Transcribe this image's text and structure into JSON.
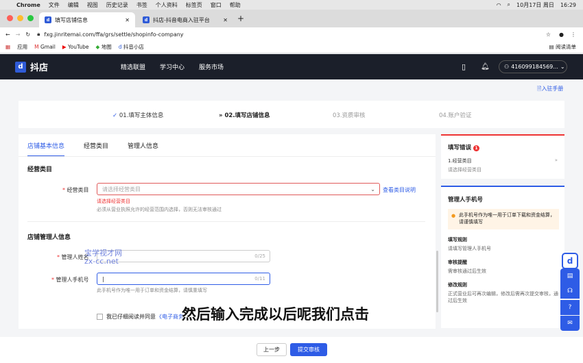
{
  "macbar": {
    "apple": "",
    "app": "Chrome",
    "menus": [
      "文件",
      "编辑",
      "视图",
      "历史记录",
      "书签",
      "个人资料",
      "标签页",
      "窗口",
      "帮助"
    ],
    "date": "10月17日 周日",
    "time": "16:29"
  },
  "tabs": [
    {
      "title": "填写店铺信息",
      "active": true
    },
    {
      "title": "抖店-抖音电商入驻平台",
      "active": false
    }
  ],
  "url": "fxg.jinritemai.com/ffa/grs/settle/shopinfo-company",
  "bookmarks": [
    "应用",
    "Gmail",
    "YouTube",
    "地图",
    "抖音小店"
  ],
  "reading_list": "阅读清单",
  "header": {
    "logo": "抖店",
    "nav": [
      "精选联盟",
      "学习中心",
      "服务市场"
    ],
    "account": "416099184569..."
  },
  "entry_manual": "入驻手册",
  "steps": [
    {
      "label": "01.填写主体信息",
      "state": "done"
    },
    {
      "label": "02.填写店铺信息",
      "state": "current"
    },
    {
      "label": "03.资质审核",
      "state": "todo"
    },
    {
      "label": "04.账户验证",
      "state": "todo"
    }
  ],
  "form_tabs": [
    "店铺基本信息",
    "经营类目",
    "管理人信息"
  ],
  "category": {
    "section": "经营类目",
    "label": "经营类目",
    "placeholder": "请选择经营类目",
    "link": "查看类目说明",
    "error": "请选择经营类目",
    "hint": "必须从营业执照允许的经营范围内选择，否则无法审核通过"
  },
  "manager": {
    "section": "店铺管理人信息",
    "name_label": "管理人姓名",
    "name_count": "0/25",
    "phone_label": "管理人手机号",
    "phone_count": "0/11",
    "phone_hint": "此手机号作为唯一用于订单和资金结算，请慎重填写"
  },
  "agree": {
    "text": "我已仔细阅读并同意",
    "link": "《电子商务",
    "rest": "…"
  },
  "buttons": {
    "prev": "上一步",
    "submit": "提交审核"
  },
  "errors_panel": {
    "title": "填写错误",
    "count": "1",
    "item_title": "1.经营类目",
    "item_desc": "请选择经营类目"
  },
  "phone_panel": {
    "title": "管理人手机号",
    "notice": "此手机号作为唯一用于订单下载和资金结算，请谨慎填写",
    "sections": [
      {
        "h": "填写规则",
        "p": "请填写管理人手机号"
      },
      {
        "h": "审核提醒",
        "p": "需审核通过后生效"
      },
      {
        "h": "修改规则",
        "p": "正式营业后可再次编辑，修改后需再次提交审核，通过后生效"
      }
    ]
  },
  "watermark": {
    "line1": "宝学视才网",
    "line2": "zx-cc.net"
  },
  "subtitle": "然后输入完成以后呢我们点击"
}
